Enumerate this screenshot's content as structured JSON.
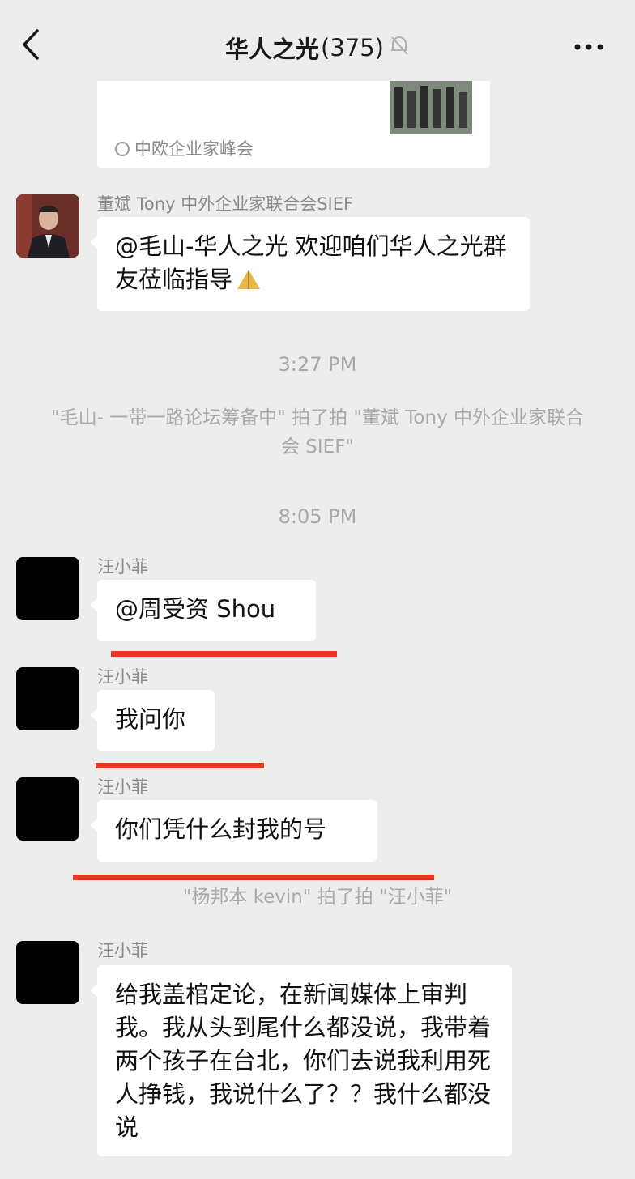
{
  "header": {
    "title": "华人之光",
    "count": "(375)"
  },
  "card": {
    "source": "中欧企业家峰会"
  },
  "messages": [
    {
      "sender": "董斌 Tony 中外企业家联合会SIEF",
      "text": "@毛山-华人之光 欢迎咱们华人之光群友莅临指导"
    },
    {
      "sender": "汪小菲",
      "text": "@周受资 Shou"
    },
    {
      "sender": "汪小菲",
      "text": "我问你"
    },
    {
      "sender": "汪小菲",
      "text": "你们凭什么封我的号"
    },
    {
      "sender": "汪小菲",
      "text": "给我盖棺定论，在新闻媒体上审判我。我从头到尾什么都没说，我带着两个孩子在台北，你们去说我利用死人挣钱，我说什么了？？我什么都没说"
    }
  ],
  "timestamps": [
    "3:27 PM",
    "8:05 PM"
  ],
  "system": [
    "\"毛山- 一带一路论坛筹备中\" 拍了拍 \"董斌 Tony 中外企业家联合会 SIEF\"",
    "\"杨邦本 kevin\" 拍了拍 \"汪小菲\""
  ],
  "colors": {
    "background": "#ededed",
    "bubble": "#ffffff",
    "annotation_underline": "#e53a24"
  },
  "icons": [
    "back-arrow-icon",
    "mute-bell-icon",
    "more-dots-icon"
  ]
}
